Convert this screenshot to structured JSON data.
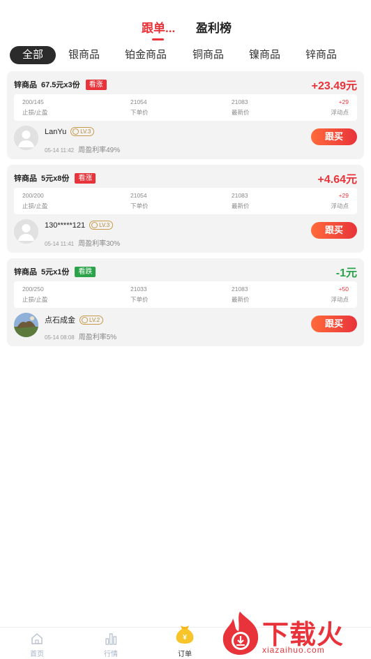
{
  "top_tabs": [
    {
      "label": "跟单..."
    },
    {
      "label": "盈利榜"
    }
  ],
  "categories": [
    "全部",
    "银商品",
    "铂金商品",
    "铜商品",
    "镍商品",
    "锌商品"
  ],
  "orders": [
    {
      "product": "锌商品",
      "qty": "67.5元x3份",
      "direction": "看涨",
      "pnl": "+23.49元",
      "stop": "200/145",
      "stop_label": "止损/止盈",
      "entry": "21054",
      "entry_label": "下单价",
      "latest": "21083",
      "latest_label": "最新价",
      "float": "+29",
      "float_label": "浮动点",
      "user": "LanYu",
      "level": "LV.3",
      "time": "05-14 11:42",
      "rate": "周盈利率49%",
      "button": "跟买"
    },
    {
      "product": "锌商品",
      "qty": "5元x8份",
      "direction": "看涨",
      "pnl": "+4.64元",
      "stop": "200/200",
      "stop_label": "止损/止盈",
      "entry": "21054",
      "entry_label": "下单价",
      "latest": "21083",
      "latest_label": "最新价",
      "float": "+29",
      "float_label": "浮动点",
      "user": "130*****121",
      "level": "LV.3",
      "time": "05-14 11:41",
      "rate": "周盈利率30%",
      "button": "跟买"
    },
    {
      "product": "锌商品",
      "qty": "5元x1份",
      "direction": "看跌",
      "pnl": "-1元",
      "stop": "200/250",
      "stop_label": "止损/止盈",
      "entry": "21033",
      "entry_label": "下单价",
      "latest": "21083",
      "latest_label": "最新价",
      "float": "+50",
      "float_label": "浮动点",
      "user": "点石成金",
      "level": "LV.2",
      "time": "05-14 08:08",
      "rate": "周盈利率5%",
      "button": "跟买"
    }
  ],
  "bottom_nav": [
    {
      "label": "首页",
      "icon": "home-icon"
    },
    {
      "label": "行情",
      "icon": "chart-icon"
    },
    {
      "label": "订单",
      "icon": "money-bag-icon"
    }
  ],
  "watermark": {
    "text": "下载火",
    "url": "xiazaihuo.com"
  },
  "colors": {
    "accent": "#e8333a",
    "down": "#2aa34a",
    "level_gold": "#c79a4a"
  }
}
